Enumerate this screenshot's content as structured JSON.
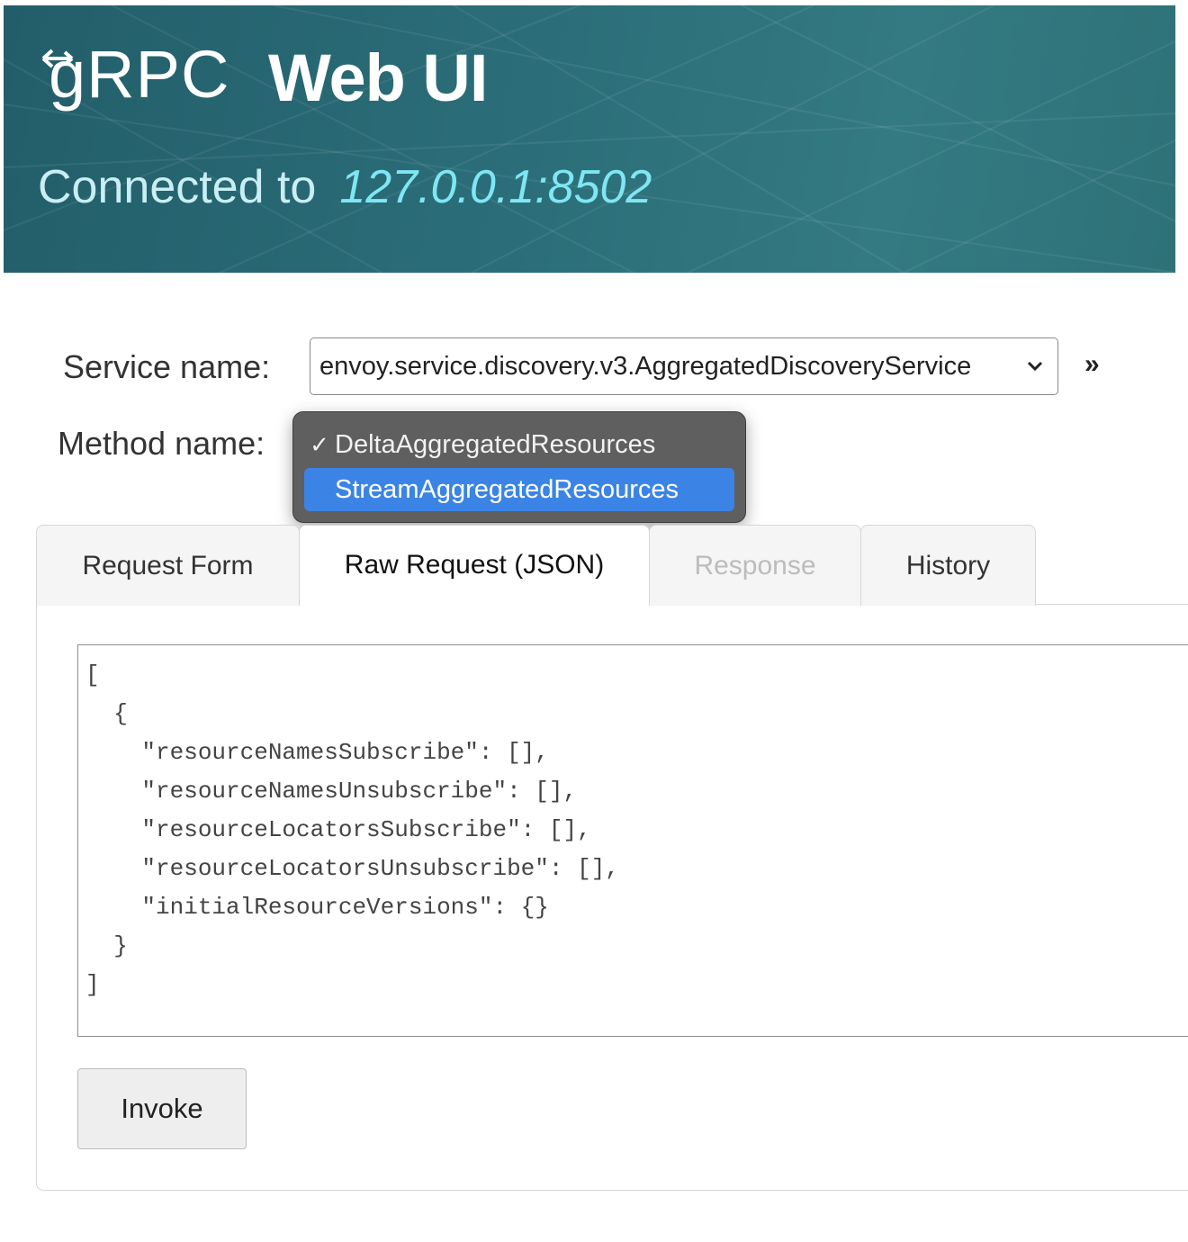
{
  "header": {
    "logo_text": "gRPC",
    "title": "Web UI",
    "connected_label": "Connected to",
    "address": "127.0.0.1:8502"
  },
  "form": {
    "service_label": "Service name:",
    "service_value": "envoy.service.discovery.v3.AggregatedDiscoveryService",
    "expand_glyph": "»",
    "method_label": "Method name:",
    "method_options": [
      {
        "label": "DeltaAggregatedResources",
        "checked": true,
        "highlighted": false
      },
      {
        "label": "StreamAggregatedResources",
        "checked": false,
        "highlighted": true
      }
    ]
  },
  "tabs": [
    {
      "label": "Request Form",
      "state": "inactive"
    },
    {
      "label": "Raw Request (JSON)",
      "state": "active"
    },
    {
      "label": "Response",
      "state": "disabled"
    },
    {
      "label": "History",
      "state": "inactive"
    }
  ],
  "editor": {
    "lines": [
      "[",
      "  {",
      "    \"resourceNamesSubscribe\": [],",
      "    \"resourceNamesUnsubscribe\": [],",
      "    \"resourceLocatorsSubscribe\": [],",
      "    \"resourceLocatorsUnsubscribe\": [],",
      "    \"initialResourceVersions\": {}",
      "  }",
      "]"
    ]
  },
  "invoke_label": "Invoke",
  "colors": {
    "header_bg": "#2b6e79",
    "address": "#7fe6f4",
    "highlight": "#3b84e6"
  }
}
